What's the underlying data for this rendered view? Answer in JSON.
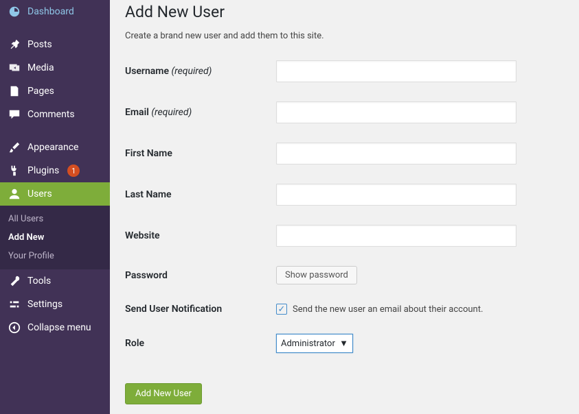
{
  "sidebar": {
    "items": [
      {
        "label": "Dashboard",
        "icon": "dashboard"
      },
      {
        "label": "Posts",
        "icon": "pin"
      },
      {
        "label": "Media",
        "icon": "media"
      },
      {
        "label": "Pages",
        "icon": "pages"
      },
      {
        "label": "Comments",
        "icon": "comment"
      },
      {
        "label": "Appearance",
        "icon": "brush"
      },
      {
        "label": "Plugins",
        "icon": "plug",
        "badge": "1"
      },
      {
        "label": "Users",
        "icon": "user",
        "active": true
      },
      {
        "label": "Tools",
        "icon": "wrench"
      },
      {
        "label": "Settings",
        "icon": "settings"
      },
      {
        "label": "Collapse menu",
        "icon": "collapse"
      }
    ],
    "submenu": [
      {
        "label": "All Users"
      },
      {
        "label": "Add New",
        "current": true
      },
      {
        "label": "Your Profile"
      }
    ]
  },
  "page": {
    "title": "Add New User",
    "description": "Create a brand new user and add them to this site.",
    "labels": {
      "username": "Username",
      "email": "Email",
      "required": "(required)",
      "firstname": "First Name",
      "lastname": "Last Name",
      "website": "Website",
      "password": "Password",
      "show_password": "Show password",
      "notification": "Send User Notification",
      "notification_text": "Send the new user an email about their account.",
      "role": "Role",
      "role_value": "Administrator",
      "submit": "Add New User"
    }
  }
}
